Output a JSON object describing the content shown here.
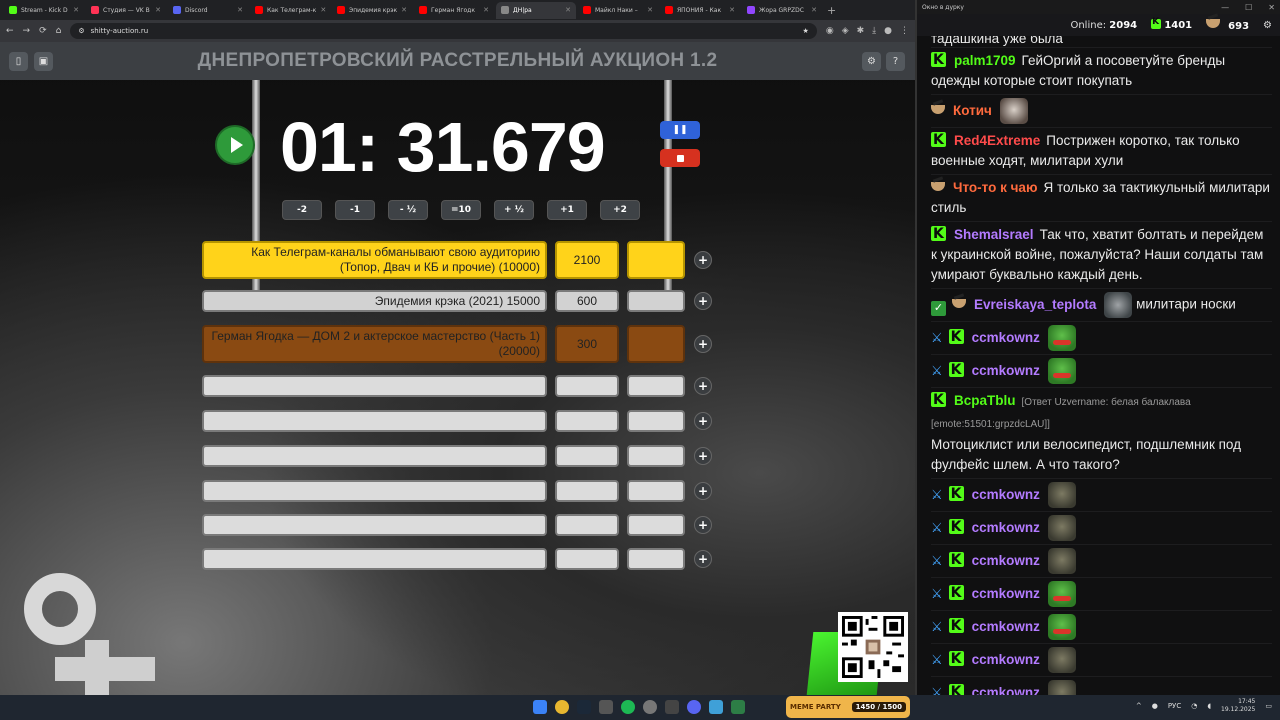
{
  "browser": {
    "tabs": [
      {
        "label": "Stream - Kick D",
        "fav": "#53fc18",
        "active": false
      },
      {
        "label": "Студия — VK В",
        "fav": "#ff3355",
        "active": false
      },
      {
        "label": "Discord",
        "fav": "#5865f2",
        "active": false
      },
      {
        "label": "Как Телеграм-к",
        "fav": "#ff0000",
        "active": false
      },
      {
        "label": "Эпидемия крэк",
        "fav": "#ff0000",
        "active": false
      },
      {
        "label": "Герман Ягодк",
        "fav": "#ff0000",
        "active": false
      },
      {
        "label": "ДН|ра",
        "fav": "#888888",
        "active": true
      },
      {
        "label": "Майкл Наки –",
        "fav": "#ff0000",
        "active": false
      },
      {
        "label": "ЯПОНИЯ - Как",
        "fav": "#ff0000",
        "active": false
      },
      {
        "label": "Жора GRPZDC",
        "fav": "#9146ff",
        "active": false
      }
    ],
    "url": "shitty-auction.ru"
  },
  "auction": {
    "title": "ДНЕПРОПЕТРОВСКИЙ РАССТРЕЛЬНЫЙ АУКЦИОН 1.2",
    "timer": "01: 31.679",
    "adjust_buttons": [
      "-2",
      "-1",
      "- ½",
      "=10",
      "+ ½",
      "+1",
      "+2"
    ],
    "lots": [
      {
        "name": "Как Телеграм-каналы обманывают свою аудиторию (Топор, Двач и КБ и прочие) (10000)",
        "amount": "2100",
        "style": "yellow"
      },
      {
        "name": "Эпидемия крэка (2021) 15000",
        "amount": "600",
        "style": "grey"
      },
      {
        "name": "Герман Ягодка — ДОМ 2 и актерское мастерство (Часть 1) (20000)",
        "amount": "300",
        "style": "brown"
      },
      {
        "name": "",
        "amount": "",
        "style": "empty"
      },
      {
        "name": "",
        "amount": "",
        "style": "empty"
      },
      {
        "name": "",
        "amount": "",
        "style": "empty"
      },
      {
        "name": "",
        "amount": "",
        "style": "empty"
      },
      {
        "name": "",
        "amount": "",
        "style": "empty"
      },
      {
        "name": "",
        "amount": "",
        "style": "empty"
      }
    ]
  },
  "chat": {
    "window_title": "Окно в дурку",
    "online_label": "Online:",
    "online_count": "2094",
    "stat_kick": "1401",
    "stat_bowl": "693",
    "top_cut": "тадашкина уже была",
    "messages": [
      {
        "badges": [
          "kick"
        ],
        "user": "palm1709",
        "color": "#53fc18",
        "text": "ГейОргий а посоветуйте бренды одежды которые стоит покупать"
      },
      {
        "badges": [
          "bowl"
        ],
        "user": "Котич",
        "color": "#ff6a3d",
        "text": "",
        "emote": "face"
      },
      {
        "badges": [
          "kick"
        ],
        "user": "Red4Extreme",
        "color": "#ff4b4b",
        "text": "Пострижен коротко, так только военные ходят, милитари хули"
      },
      {
        "badges": [
          "bowl"
        ],
        "user": "Что-то к чаю",
        "color": "#ff6a3d",
        "text": "Я только за тактикульный милитари стиль"
      },
      {
        "badges": [
          "kick"
        ],
        "user": "Shemalsrael",
        "color": "#b37bff",
        "text": "Так что, хватит болтать и перейдем к украинской войне, пожалуйста? Наши солдаты там умирают буквально каждый день."
      },
      {
        "badges": [
          "check",
          "bowl"
        ],
        "user": "Evreiskaya_teplota",
        "color": "#b37bff",
        "text": "милитари носки",
        "emote": "tank",
        "emote_first": true
      },
      {
        "badges": [
          "sword",
          "kick"
        ],
        "user": "ccmkownz",
        "color": "#b37bff",
        "text": "",
        "emote": "pepe"
      },
      {
        "badges": [
          "sword",
          "kick"
        ],
        "user": "ccmkownz",
        "color": "#b37bff",
        "text": "",
        "emote": "pepe"
      },
      {
        "badges": [
          "kick"
        ],
        "user": "BcpaTblu",
        "color": "#53fc18",
        "reply": "[Ответ Uzvername: белая балаклава [emote:51501:grpzdcLAU]]",
        "text": "Мотоциклист или велосипедист, подшлемник под фулфейс шлем. А что такого?"
      },
      {
        "badges": [
          "sword",
          "kick"
        ],
        "user": "ccmkownz",
        "color": "#b37bff",
        "text": "",
        "emote": "dark"
      },
      {
        "badges": [
          "sword",
          "kick"
        ],
        "user": "ccmkownz",
        "color": "#b37bff",
        "text": "",
        "emote": "dark"
      },
      {
        "badges": [
          "sword",
          "kick"
        ],
        "user": "ccmkownz",
        "color": "#b37bff",
        "text": "",
        "emote": "dark"
      },
      {
        "badges": [
          "sword",
          "kick"
        ],
        "user": "ccmkownz",
        "color": "#b37bff",
        "text": "",
        "emote": "pepe"
      },
      {
        "badges": [
          "sword",
          "kick"
        ],
        "user": "ccmkownz",
        "color": "#b37bff",
        "text": "",
        "emote": "pepe"
      },
      {
        "badges": [
          "sword",
          "kick"
        ],
        "user": "ccmkownz",
        "color": "#b37bff",
        "text": "",
        "emote": "dark"
      },
      {
        "badges": [
          "sword",
          "kick"
        ],
        "user": "ccmkownz",
        "color": "#b37bff",
        "text": "",
        "emote": "dark"
      }
    ]
  },
  "taskbar": {
    "meme_label": "MEME PARTY",
    "meme_progress": "1450 / 1500",
    "lang": "РУС",
    "time": "17:45",
    "date": "19.12.2025"
  }
}
